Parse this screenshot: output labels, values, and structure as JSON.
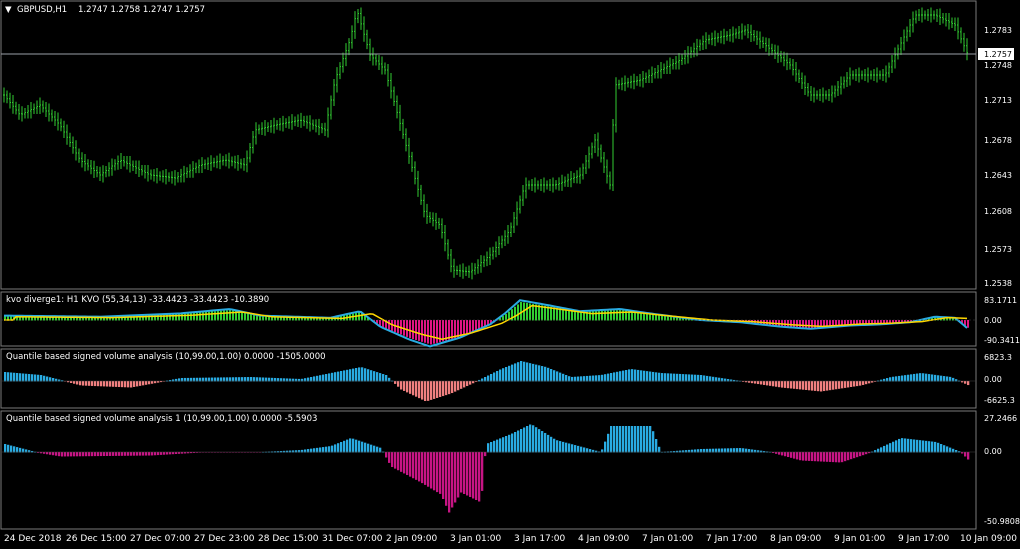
{
  "main": {
    "symbol_label": "GBPUSD,H1",
    "ohlc_text": "1.2747 1.2758 1.2747 1.2757",
    "current_price": "1.2757",
    "price_ticks": [
      "1.2783",
      "1.2748",
      "1.2713",
      "1.2678",
      "1.2643",
      "1.2608",
      "1.2573",
      "1.2538"
    ],
    "candle_color": "#32cd32"
  },
  "kvo": {
    "title": "kvo diverge1: H1  KVO (55,34,13) -33.4423 -33.4423 -10.3890",
    "ticks": [
      "83.1711",
      "0.00",
      "-90.3411"
    ]
  },
  "qsva1": {
    "title": "Quantile based signed volume analysis (10,99.00,1.00) 0.0000 -1505.0000",
    "ticks": [
      "6823.3",
      "0.00",
      "-6625.3"
    ]
  },
  "qsva2": {
    "title": "Quantile based signed volume analysis 1 (10,99.00,1.00) 0.0000 -5.5903",
    "ticks": [
      "27.2466",
      "0.00",
      "-50.9808"
    ]
  },
  "time_axis": [
    "24 Dec 2018",
    "26 Dec 15:00",
    "27 Dec 07:00",
    "27 Dec 23:00",
    "28 Dec 15:00",
    "31 Dec 07:00",
    "2 Jan 09:00",
    "3 Jan 01:00",
    "3 Jan 17:00",
    "4 Jan 09:00",
    "7 Jan 01:00",
    "7 Jan 17:00",
    "8 Jan 09:00",
    "9 Jan 01:00",
    "9 Jan 17:00",
    "10 Jan 09:00"
  ],
  "colors": {
    "bull": "#32cd32",
    "up_hist": "#29abe2",
    "down_hist": "#f08080",
    "down_hist2": "#c71585",
    "kvo_line": "#ffd700",
    "kvo_sig": "#29abe2"
  }
}
